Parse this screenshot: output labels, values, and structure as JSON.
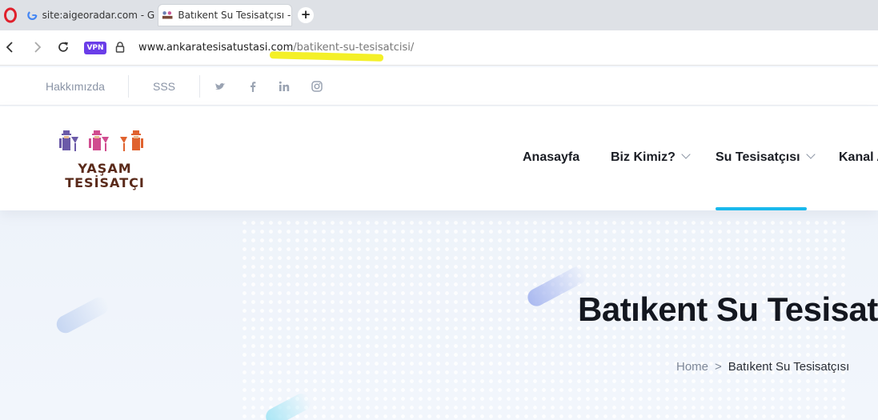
{
  "browser": {
    "tabs": [
      {
        "label": "site:aigeoradar.com - Goo",
        "icon": "google-g-icon"
      },
      {
        "label": "Batıkent Su Tesisatçısı - Ar",
        "icon": "site-favicon-icon",
        "active": true
      }
    ],
    "new_tab_label": "+",
    "vpn_label": "VPN",
    "url": {
      "domain": "www.ankaratesisatustasi.com",
      "path": "/batikent-su-tesisatcisi/"
    },
    "highlight_color": "#f3ef1c"
  },
  "topbar": {
    "links": [
      "Hakkımızda",
      "SSS"
    ],
    "social_icons": [
      "twitter-icon",
      "facebook-icon",
      "linkedin-icon",
      "instagram-icon"
    ]
  },
  "header": {
    "logo": {
      "line1": "YAŞAM",
      "line2": "TESİSATÇI"
    },
    "menu": [
      {
        "label": "Anasayfa",
        "dropdown": false
      },
      {
        "label": "Biz Kimiz?",
        "dropdown": true
      },
      {
        "label": "Su Tesisatçısı",
        "dropdown": true,
        "active": true
      },
      {
        "label": "Kanal A",
        "dropdown": false
      }
    ],
    "active_color": "#19b8ec"
  },
  "hero": {
    "title": "Batıkent Su Tesisat",
    "breadcrumb": {
      "home": "Home",
      "separator": ">",
      "current": "Batıkent Su Tesisatçısı"
    }
  }
}
